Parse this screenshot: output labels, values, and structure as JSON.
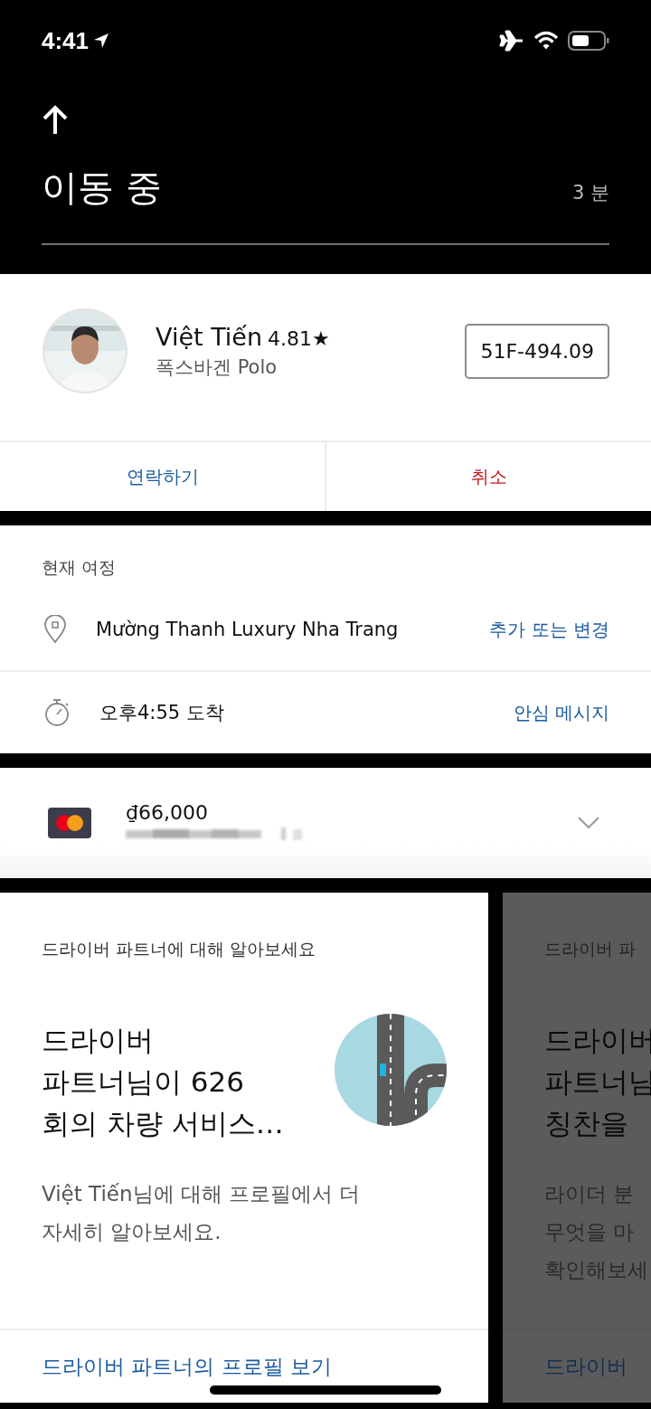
{
  "status_bar": {
    "time": "4:41"
  },
  "header": {
    "title": "이동 중",
    "eta": "3 분"
  },
  "driver": {
    "name": "Việt Tiến",
    "rating": "4.81★",
    "car": "폭스바겐 Polo",
    "plate": "51F-494.09"
  },
  "actions": [
    {
      "label": "연락하기",
      "kind": "primary"
    },
    {
      "label": "취소",
      "kind": "danger"
    }
  ],
  "trip": {
    "heading": "현재 여정",
    "rows": [
      {
        "kind": "place",
        "text": "Mường Thanh Luxury Nha Trang",
        "action": "추가 또는 변경"
      },
      {
        "kind": "time",
        "text": "오후4:55 도착",
        "action": "안심 메시지"
      }
    ]
  },
  "payment": {
    "amount": "₫66,000"
  },
  "cards": [
    {
      "dimmed": false,
      "eyebrow": "드라이버 파트너에 대해 알아보세요",
      "title": [
        "드라이버",
        "파트너님이 626",
        "회의 차량 서비스…"
      ],
      "body": [
        "Việt Tiến님에 대해 프로필에서 더",
        "자세히 알아보세요."
      ],
      "link": "드라이버 파트너의 프로필 보기"
    },
    {
      "dimmed": true,
      "eyebrow": "드라이버 파",
      "title": [
        "드라이버",
        "파트너님",
        "칭찬을"
      ],
      "body": [
        "라이더 분",
        "무엇을 마",
        "확인해보세"
      ],
      "link": "드라이버"
    }
  ]
}
